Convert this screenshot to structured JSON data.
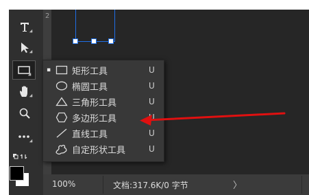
{
  "toolbar": {
    "tools": [
      {
        "name": "type-tool",
        "icon": "type-icon"
      },
      {
        "name": "path-selection-tool",
        "icon": "arrow-selection-icon"
      },
      {
        "name": "shape-tool",
        "icon": "rectangle-icon",
        "active": true
      },
      {
        "name": "hand-tool",
        "icon": "hand-icon"
      },
      {
        "name": "zoom-tool",
        "icon": "magnifier-icon"
      },
      {
        "name": "more-tools",
        "icon": "ellipsis-icon"
      }
    ],
    "foreground_color": "#000000",
    "background_color": "#ffffff"
  },
  "ruler": {
    "tick_label": "2"
  },
  "shape_menu": {
    "items": [
      {
        "label": "矩形工具",
        "shortcut": "U",
        "icon": "rectangle-icon",
        "selected": true
      },
      {
        "label": "椭圆工具",
        "shortcut": "U",
        "icon": "ellipse-icon"
      },
      {
        "label": "三角形工具",
        "shortcut": "U",
        "icon": "triangle-icon"
      },
      {
        "label": "多边形工具",
        "shortcut": "U",
        "icon": "polygon-icon"
      },
      {
        "label": "直线工具",
        "shortcut": "U",
        "icon": "line-icon"
      },
      {
        "label": "自定形状工具",
        "shortcut": "U",
        "icon": "custom-shape-icon"
      }
    ],
    "selected_marker": "▪"
  },
  "statusbar": {
    "zoom": "100%",
    "doc_info": "文档:317.6K/0 字节",
    "arrow": "〉"
  },
  "annotation": {
    "color": "#e01010",
    "target": "多边形工具"
  },
  "colors": {
    "panel": "#2f2f2f",
    "menu_bg": "#383838",
    "canvas": "#262626",
    "selection_blue": "#1f6fe8"
  }
}
